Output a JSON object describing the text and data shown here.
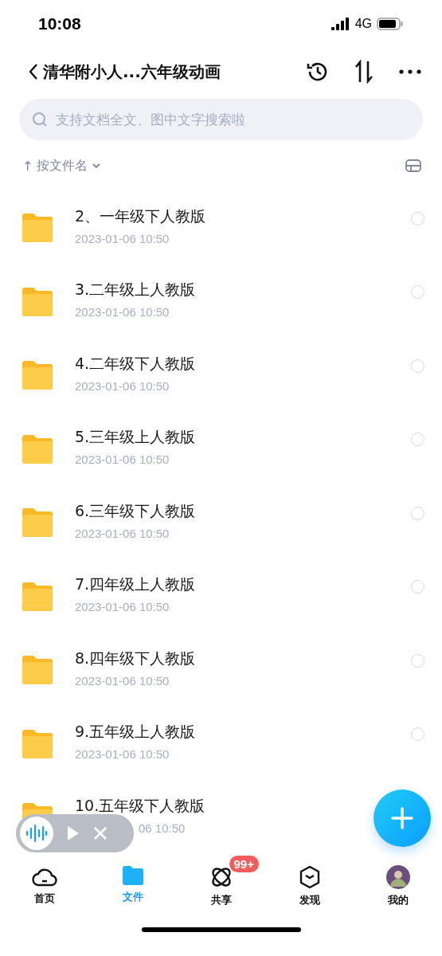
{
  "status_bar": {
    "time": "10:08",
    "network": "4G"
  },
  "header": {
    "title": "清华附小人...六年级动画"
  },
  "search": {
    "placeholder": "支持文档全文、图中文字搜索啦"
  },
  "sort": {
    "arrow": "↑",
    "label": "按文件名"
  },
  "files": [
    {
      "name": "2、一年级下人教版",
      "date": "2023-01-06 10:50",
      "checked": false,
      "covered": false
    },
    {
      "name": "3.二年级上人教版",
      "date": "2023-01-06 10:50",
      "checked": false,
      "covered": false
    },
    {
      "name": "4.二年级下人教版",
      "date": "2023-01-06 10:50",
      "checked": false,
      "covered": false
    },
    {
      "name": "5.三年级上人教版",
      "date": "2023-01-06 10:50",
      "checked": false,
      "covered": false
    },
    {
      "name": "6.三年级下人教版",
      "date": "2023-01-06 10:50",
      "checked": false,
      "covered": false
    },
    {
      "name": "7.四年级上人教版",
      "date": "2023-01-06 10:50",
      "checked": false,
      "covered": false
    },
    {
      "name": "8.四年级下人教版",
      "date": "2023-01-06 10:50",
      "checked": false,
      "covered": false
    },
    {
      "name": "9.五年级上人教版",
      "date": "2023-01-06 10:50",
      "checked": false,
      "covered": false
    },
    {
      "name": "10.五年级下人教版",
      "date": "06 10:50",
      "covered": true
    }
  ],
  "nav": [
    {
      "kind": "cloud",
      "label": "首页",
      "selected": false
    },
    {
      "kind": "folder",
      "label": "文件",
      "selected": true
    },
    {
      "kind": "orbit",
      "label": "共享",
      "selected": false,
      "badge": "99+"
    },
    {
      "kind": "cube",
      "label": "发现",
      "selected": false
    },
    {
      "kind": "avatar",
      "label": "我的",
      "selected": false
    }
  ]
}
